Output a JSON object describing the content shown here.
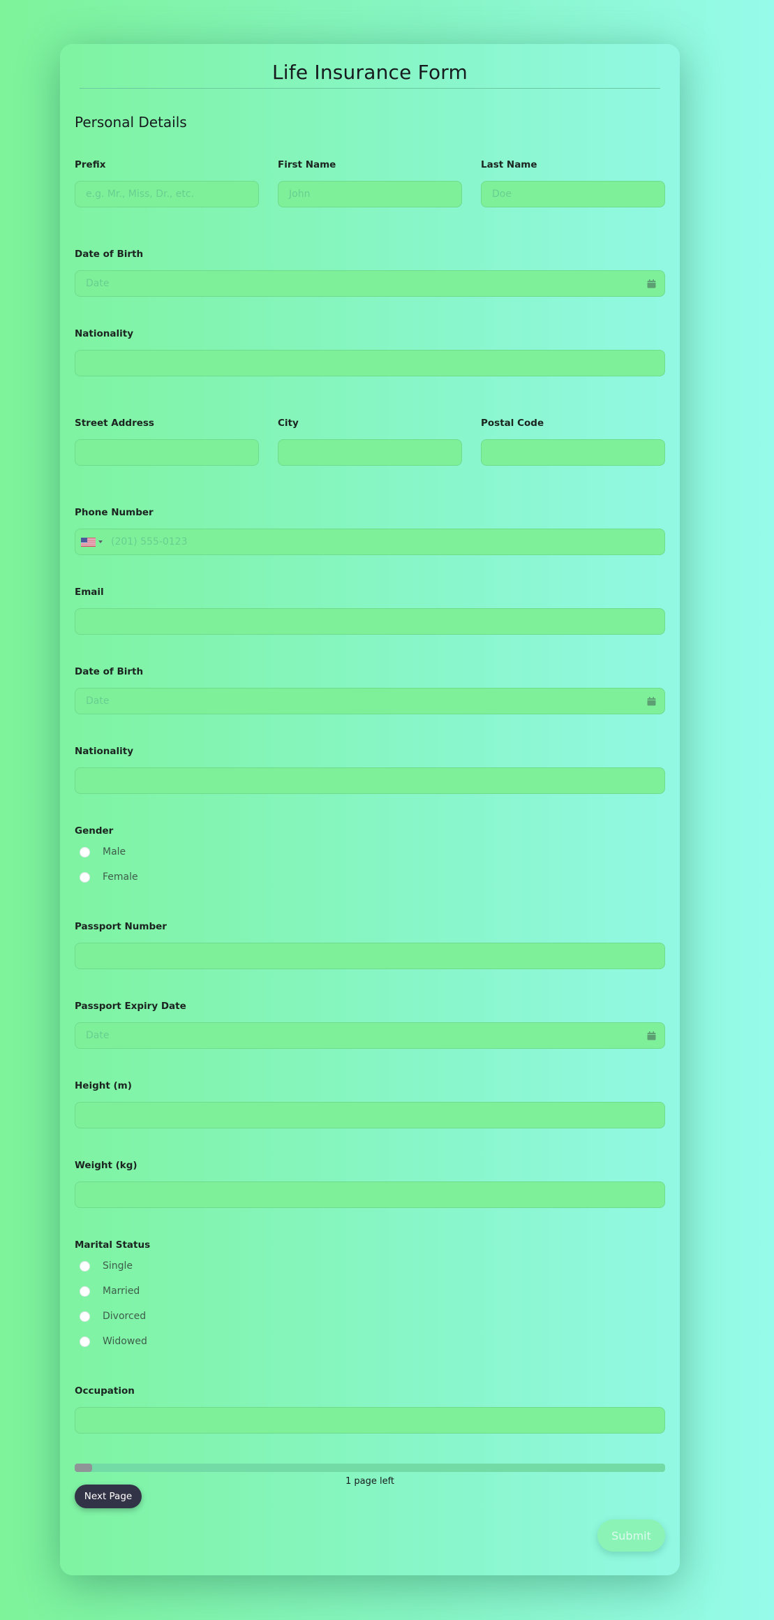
{
  "form": {
    "title": "Life Insurance Form",
    "section_heading": "Personal Details"
  },
  "fields": {
    "prefix": {
      "label": "Prefix",
      "placeholder": "e.g. Mr., Miss, Dr., etc.",
      "value": ""
    },
    "first_name": {
      "label": "First Name",
      "placeholder": "John",
      "value": ""
    },
    "last_name": {
      "label": "Last Name",
      "placeholder": "Doe",
      "value": ""
    },
    "dob_1": {
      "label": "Date of Birth",
      "placeholder": "Date",
      "value": "",
      "icon": "calendar-icon"
    },
    "nationality_1": {
      "label": "Nationality",
      "placeholder": "",
      "value": ""
    },
    "street_address": {
      "label": "Street Address",
      "placeholder": "",
      "value": ""
    },
    "city": {
      "label": "City",
      "placeholder": "",
      "value": ""
    },
    "postal_code": {
      "label": "Postal Code",
      "placeholder": "",
      "value": ""
    },
    "phone": {
      "label": "Phone Number",
      "placeholder": "(201) 555-0123",
      "value": "",
      "country_flag": "us-flag-icon"
    },
    "email": {
      "label": "Email",
      "placeholder": "",
      "value": ""
    },
    "dob_2": {
      "label": "Date of Birth",
      "placeholder": "Date",
      "value": "",
      "icon": "calendar-icon"
    },
    "nationality_2": {
      "label": "Nationality",
      "placeholder": "",
      "value": ""
    },
    "gender": {
      "label": "Gender",
      "options": [
        "Male",
        "Female"
      ],
      "selected": null
    },
    "passport_number": {
      "label": "Passport Number",
      "placeholder": "",
      "value": ""
    },
    "passport_expiry": {
      "label": "Passport Expiry Date",
      "placeholder": "Date",
      "value": "",
      "icon": "calendar-icon"
    },
    "height": {
      "label": "Height (m)",
      "placeholder": "",
      "value": ""
    },
    "weight": {
      "label": "Weight (kg)",
      "placeholder": "",
      "value": ""
    },
    "marital_status": {
      "label": "Marital Status",
      "options": [
        "Single",
        "Married",
        "Divorced",
        "Widowed"
      ],
      "selected": null
    },
    "occupation": {
      "label": "Occupation",
      "placeholder": "",
      "value": ""
    }
  },
  "progress": {
    "percent": 3,
    "text": "1 page left"
  },
  "buttons": {
    "next_page": "Next Page",
    "submit": "Submit"
  },
  "colors": {
    "accent_dark": "#333347",
    "input_bg": "#7ff09a",
    "submit_bg": "#8cf3b6",
    "progress_fill": "#8f9597"
  }
}
